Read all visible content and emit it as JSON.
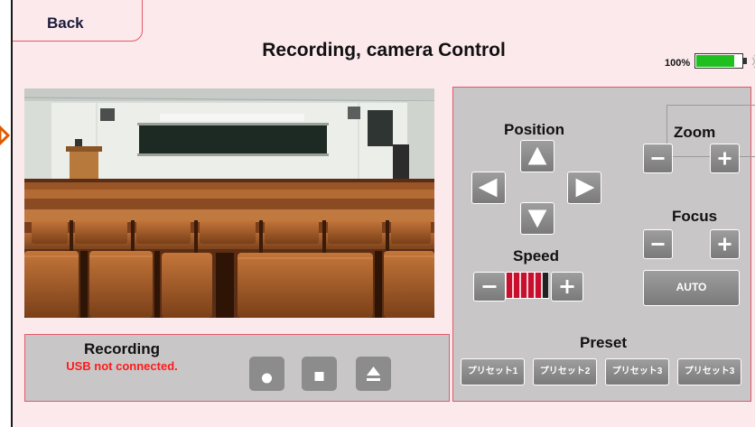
{
  "header": {
    "back_label": "Back",
    "title": "Recording, camera Control",
    "battery_percent_text": "100%",
    "battery_level": 0.85
  },
  "recording": {
    "title": "Recording",
    "status": "USB not connected.",
    "buttons": [
      "record-icon",
      "stop-icon",
      "eject-icon"
    ]
  },
  "camera": {
    "position_label": "Position",
    "speed_label": "Speed",
    "zoom_label": "Zoom",
    "focus_label": "Focus",
    "auto_label": "AUTO",
    "speed_level": 5,
    "speed_max": 6
  },
  "preset": {
    "label": "Preset",
    "items": [
      "プリセット1",
      "プリセット2",
      "プリセット3",
      "プリセット3"
    ]
  },
  "colors": {
    "accent_border": "#e05a6a",
    "battery_green": "#1fbf1f",
    "status_red": "#ff1a1a",
    "speed_red": "#c8102e"
  }
}
